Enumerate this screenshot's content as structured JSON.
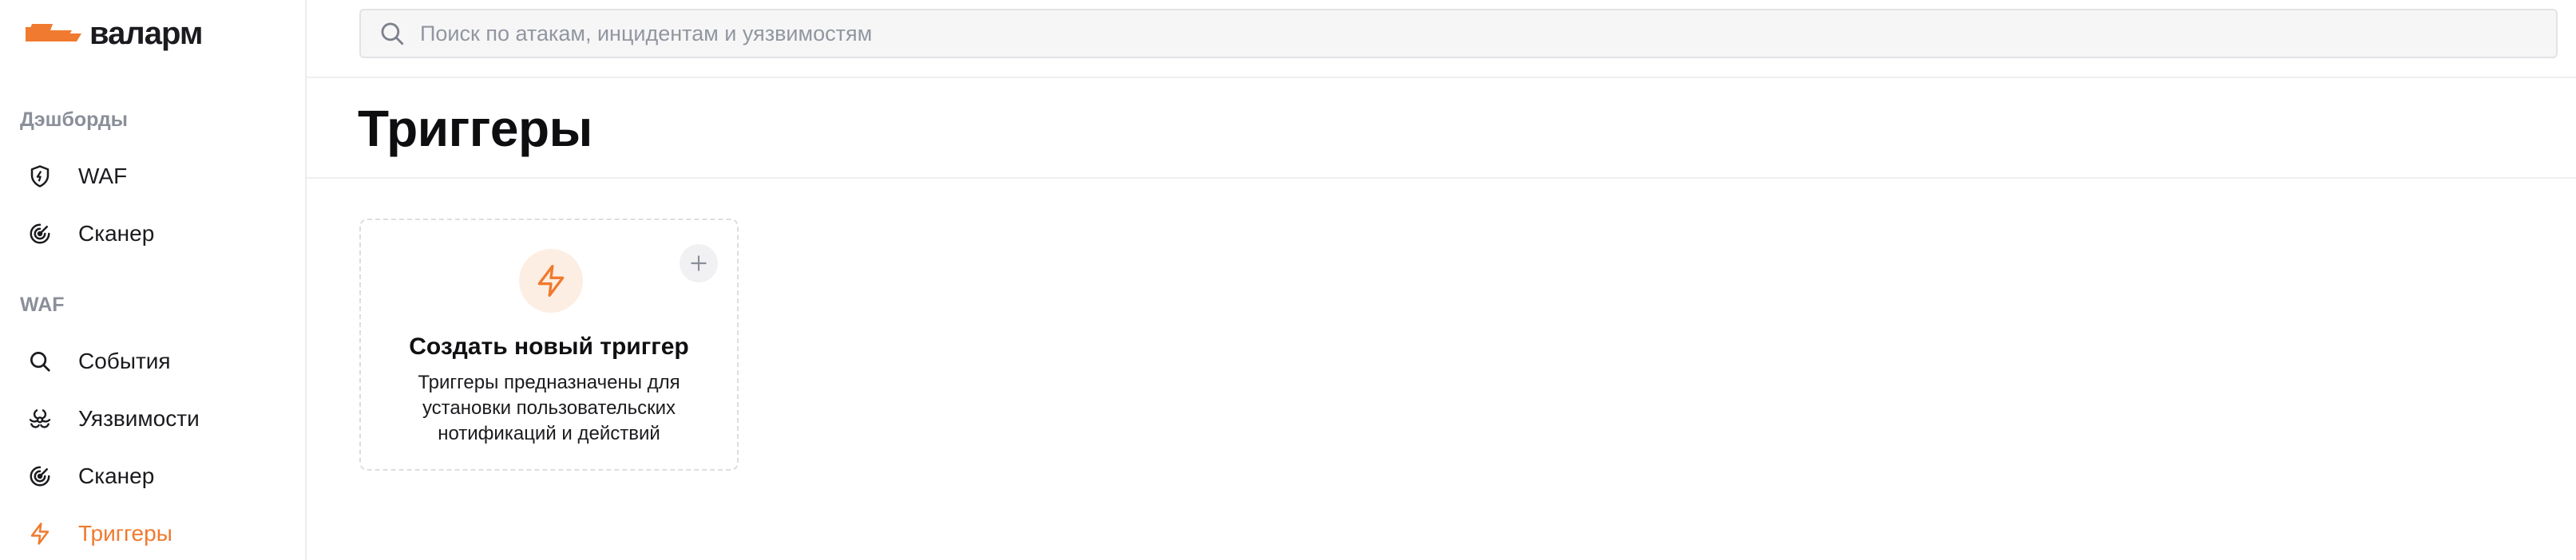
{
  "brand": {
    "name": "валарм",
    "accent_color": "#F07A2F"
  },
  "sidebar": {
    "sections": [
      {
        "title": "Дэшборды",
        "items": [
          {
            "label": "WAF",
            "icon": "shield-icon",
            "active": false
          },
          {
            "label": "Сканер",
            "icon": "scanner-icon",
            "active": false
          }
        ]
      },
      {
        "title": "WAF",
        "items": [
          {
            "label": "События",
            "icon": "search-icon",
            "active": false
          },
          {
            "label": "Уязвимости",
            "icon": "biohazard-icon",
            "active": false
          },
          {
            "label": "Сканер",
            "icon": "scanner-icon",
            "active": false
          },
          {
            "label": "Триггеры",
            "icon": "lightning-icon",
            "active": true
          }
        ]
      }
    ]
  },
  "search": {
    "placeholder": "Поиск по атакам, инцидентам и уязвимостям",
    "value": ""
  },
  "page": {
    "title": "Триггеры"
  },
  "create_card": {
    "title": "Создать новый триггер",
    "description": "Триггеры предназначены для установки пользовательских нотификаций и действий",
    "icon": "lightning-icon",
    "add_icon": "plus-icon"
  }
}
